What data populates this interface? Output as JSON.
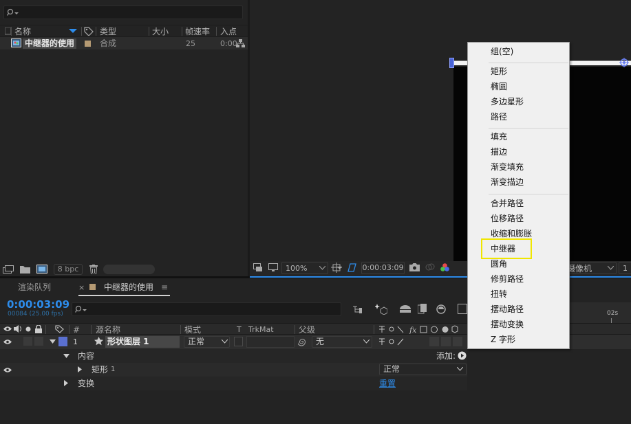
{
  "project": {
    "columns": {
      "name": "名称",
      "type": "类型",
      "size": "大小",
      "fps": "帧速率",
      "in": "入点"
    },
    "item": {
      "name": "中继器的使用",
      "type": "合成",
      "fps": "25",
      "in": "0:00"
    },
    "bpc": "8 bpc"
  },
  "viewer": {
    "zoom": "100%",
    "timecode": "0:00:03:09",
    "camera": "摄像机",
    "camera_prefix": "1"
  },
  "timeline": {
    "tabs": {
      "render_queue": "渲染队列",
      "comp_tab": "中继器的使用"
    },
    "timecode": "0:00:03:09",
    "frame_info": "00084 (25.00 fps)",
    "columns": {
      "num": "#",
      "source": "源名称",
      "mode": "模式",
      "t": "T",
      "trkmat": "TrkMat",
      "parent": "父级"
    },
    "layer": {
      "num": "1",
      "name": "形状图层 1",
      "mode": "正常",
      "parent": "无"
    },
    "contents_label": "内容",
    "add_label": "添加:",
    "rect": {
      "name": "矩形",
      "index": "1",
      "mode": "正常"
    },
    "transform_label": "变换",
    "reset_label": "重置",
    "ruler_label": "02s"
  },
  "menu": {
    "items": [
      "组(空)",
      "矩形",
      "椭圆",
      "多边星形",
      "路径",
      "填充",
      "描边",
      "渐变填充",
      "渐变描边",
      "合并路径",
      "位移路径",
      "收缩和膨胀",
      "中继器",
      "圆角",
      "修剪路径",
      "扭转",
      "摆动路径",
      "摆动变换",
      "Z 字形"
    ],
    "highlighted": "中继器"
  },
  "colors": {
    "accent": "#2d8ceb",
    "highlight_box": "#f0e600",
    "label_blue": "#5a70d0",
    "comp_label": "#b59a73"
  }
}
